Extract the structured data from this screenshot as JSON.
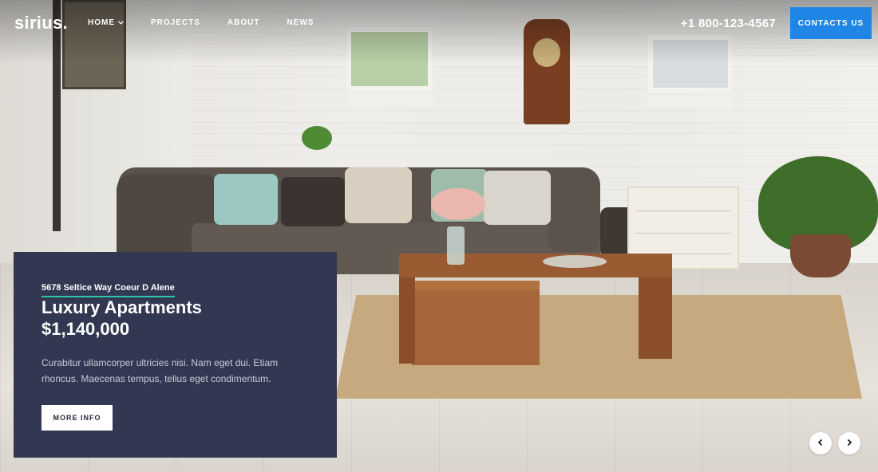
{
  "brand": {
    "logo": "sirius."
  },
  "nav": {
    "items": [
      {
        "label": "HOME",
        "has_dropdown": true
      },
      {
        "label": "PROJECTS"
      },
      {
        "label": "ABOUT"
      },
      {
        "label": "NEWS"
      }
    ],
    "phone": "+1 800-123-4567",
    "contact_button": "CONTACTS US"
  },
  "hero": {
    "icons": {
      "dropdown": "chevron-down-icon",
      "prev": "chevron-left-icon",
      "next": "chevron-right-icon"
    }
  },
  "card": {
    "address": "5678 Seltice Way Coeur D Alene",
    "title": "Luxury Apartments",
    "price": "$1,140,000",
    "description": "Curabitur ullamcorper ultricies nisi. Nam eget dui. Etiam rhoncus. Maecenas tempus, tellus eget condimentum.",
    "button": "MORE INFO"
  },
  "colors": {
    "accent_blue": "#1f86e6",
    "card_bg": "#323852",
    "underline_green": "#2ec4a7"
  }
}
